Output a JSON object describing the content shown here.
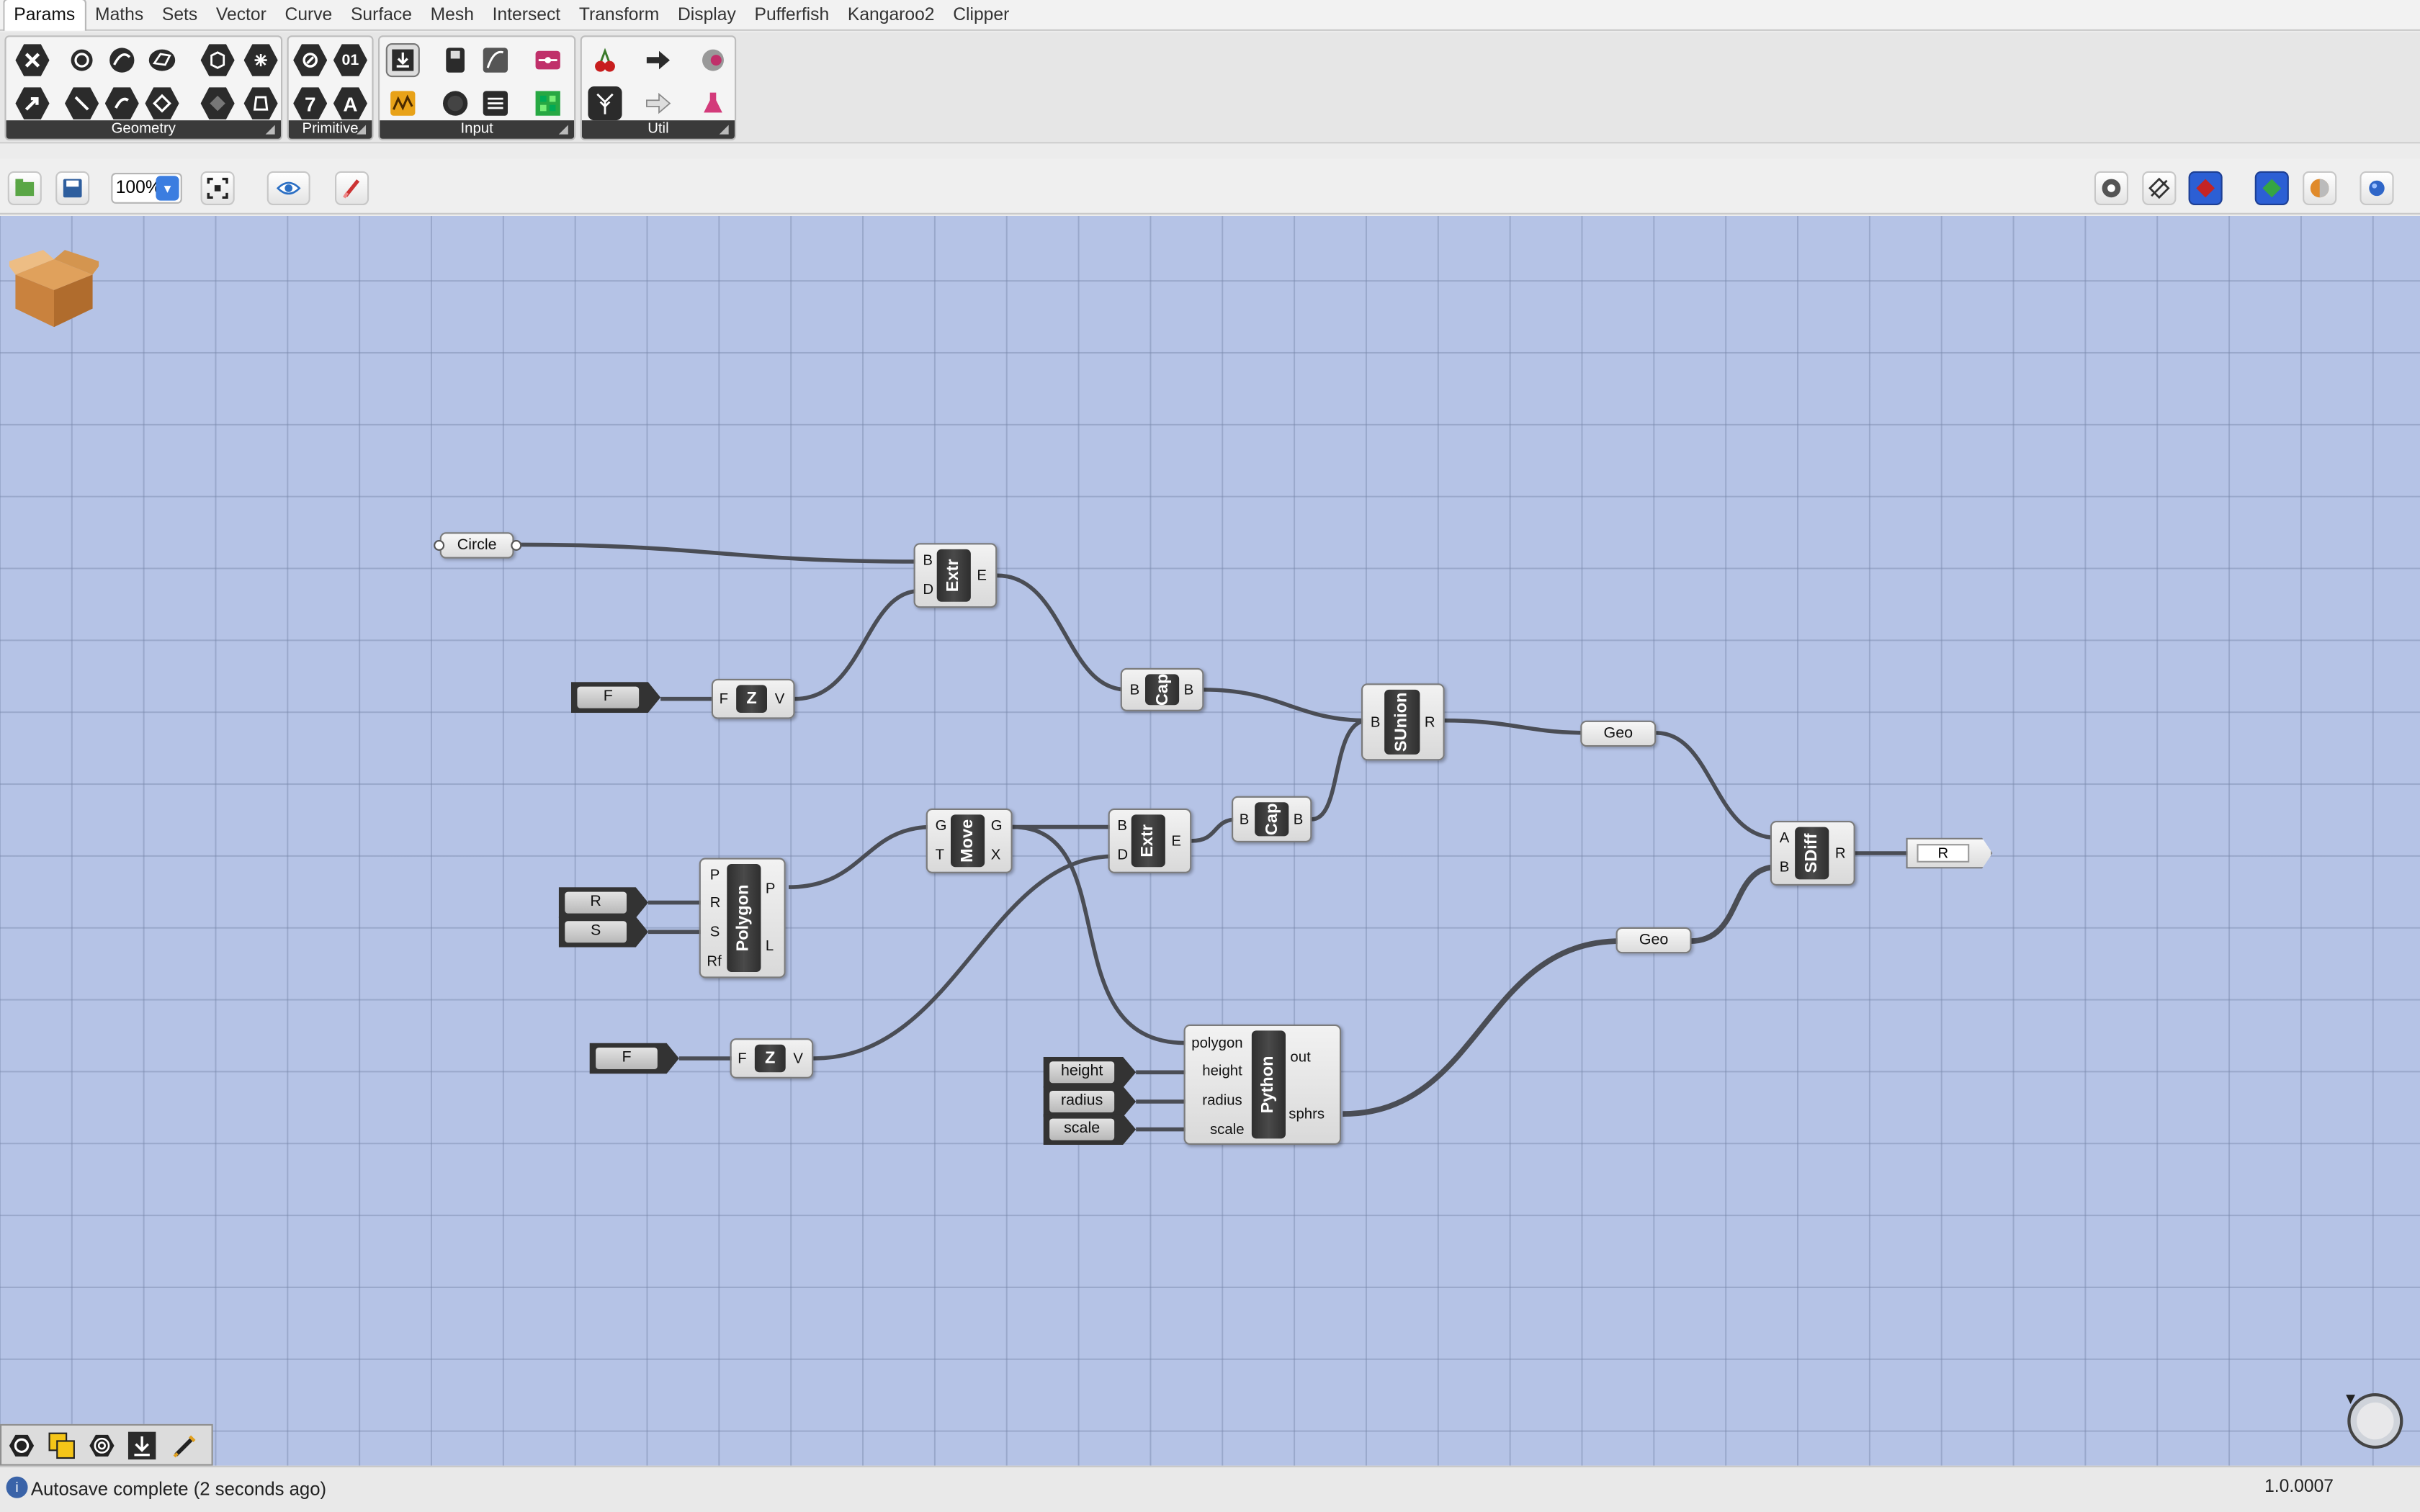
{
  "tabs": [
    "Params",
    "Maths",
    "Sets",
    "Vector",
    "Curve",
    "Surface",
    "Mesh",
    "Intersect",
    "Transform",
    "Display",
    "Pufferfish",
    "Kangaroo2",
    "Clipper"
  ],
  "ribbon": {
    "groups": [
      {
        "label": "Geometry"
      },
      {
        "label": "Primitive"
      },
      {
        "label": "Input"
      },
      {
        "label": "Util"
      }
    ],
    "icons_geometry": [
      "close-icon",
      "circle-icon",
      "curve-icon",
      "surface-icon",
      "box-icon",
      "mesh-icon",
      "arrow-icon",
      "line-icon",
      "brep-icon",
      "wire-icon",
      "transform-icon",
      "field-icon"
    ],
    "icons_primitive": [
      "boolean-icon",
      "integer-icon",
      "number-icon",
      "text-icon"
    ],
    "primitive_labels": {
      "num": "7",
      "text": "A",
      "int": "01"
    },
    "icons_input": [
      "download-icon",
      "panel-icon",
      "graph-icon",
      "slider-icon",
      "chart-icon",
      "record-icon",
      "list-icon",
      "matrix-icon"
    ],
    "icons_util": [
      "cherry-icon",
      "arrow-dark-icon",
      "tree-icon",
      "arrow-light-icon",
      "jump-icon",
      "flask-icon"
    ]
  },
  "toolbar": {
    "zoom": "100%",
    "buttons": [
      "open-icon",
      "save-icon",
      "zoom-extents-icon",
      "preview-eye-icon",
      "sketch-brush-icon"
    ],
    "right_buttons": [
      "preview-off-icon",
      "preview-wire-icon",
      "preview-shaded-icon",
      "display-selected-icon",
      "render-icon",
      "sphere-icon"
    ]
  },
  "canvas": {
    "components": {
      "extr1": {
        "name": "Extr",
        "inputs": [
          "B",
          "D"
        ],
        "outputs": [
          "E"
        ]
      },
      "z1": {
        "name": "Z",
        "inputs": [
          "F"
        ],
        "outputs": [
          "V"
        ]
      },
      "cap1": {
        "name": "Cap",
        "inputs": [
          "B"
        ],
        "outputs": [
          "B"
        ]
      },
      "sunion": {
        "name": "SUnion",
        "inputs": [
          "B"
        ],
        "outputs": [
          "R"
        ]
      },
      "move": {
        "name": "Move",
        "inputs": [
          "G",
          "T"
        ],
        "outputs": [
          "G",
          "X"
        ]
      },
      "extr2": {
        "name": "Extr",
        "inputs": [
          "B",
          "D"
        ],
        "outputs": [
          "E"
        ]
      },
      "cap2": {
        "name": "Cap",
        "inputs": [
          "B"
        ],
        "outputs": [
          "B"
        ]
      },
      "polygon": {
        "name": "Polygon",
        "inputs": [
          "P",
          "R",
          "S",
          "Rf"
        ],
        "outputs": [
          "P",
          "L"
        ]
      },
      "z2": {
        "name": "Z",
        "inputs": [
          "F"
        ],
        "outputs": [
          "V"
        ]
      },
      "python": {
        "name": "Python",
        "inputs": [
          "polygon",
          "height",
          "radius",
          "scale"
        ],
        "outputs": [
          "out",
          "sphrs"
        ]
      },
      "sdiff": {
        "name": "SDiff",
        "inputs": [
          "A",
          "B"
        ],
        "outputs": [
          "R"
        ]
      }
    },
    "params": {
      "circle": "Circle",
      "geo1": "Geo",
      "geo2": "Geo"
    },
    "sliders": {
      "f1": "F",
      "r": "R",
      "s": "S",
      "f2": "F",
      "height": "height",
      "radius": "radius",
      "scale": "scale"
    },
    "output": "R"
  },
  "bottom_icons": [
    "hexagon-icon",
    "select-icon",
    "target-icon",
    "download-small-icon",
    "pencil-icon"
  ],
  "status": "Autosave complete (2 seconds ago)",
  "version": "1.0.0007",
  "colors": {
    "canvas": "#b5c3e6",
    "wire": "#4a4d55",
    "component": "#2e2e2e"
  }
}
